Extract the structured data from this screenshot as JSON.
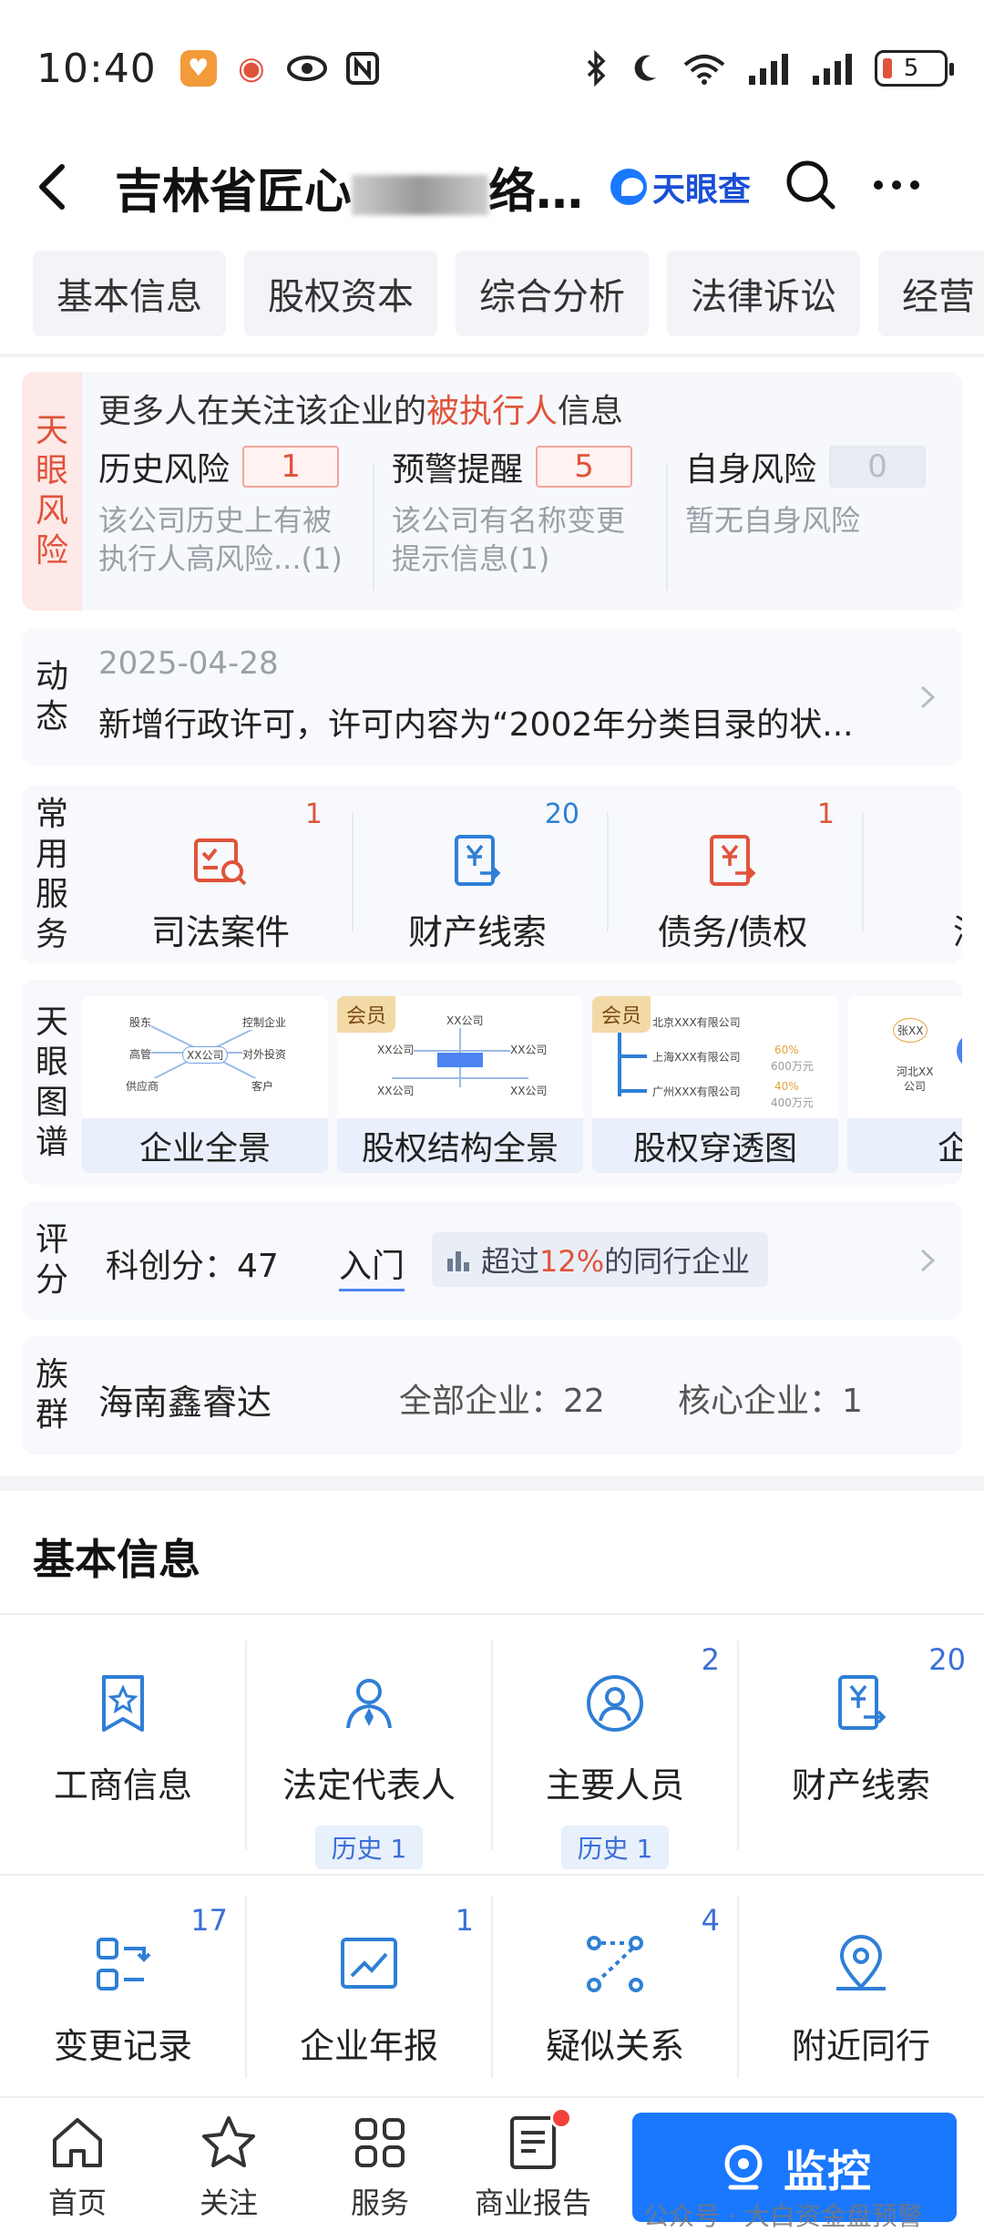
{
  "status_bar": {
    "time": "10:40",
    "battery": "5"
  },
  "header": {
    "title_prefix": "吉林省匠心",
    "title_suffix": "络...",
    "brand": "天眼查"
  },
  "tabs": [
    "基本信息",
    "股权资本",
    "综合分析",
    "法律诉讼",
    "经营"
  ],
  "risk": {
    "side_label": [
      "天",
      "眼",
      "风",
      "险"
    ],
    "headline_pre": "更多人在关注该企业的",
    "headline_hl": "被执行人",
    "headline_post": "信息",
    "items": [
      {
        "title": "历史风险",
        "count": "1",
        "desc1": "该公司历史上有被",
        "desc2": "执行人高风险...(1)"
      },
      {
        "title": "预警提醒",
        "count": "5",
        "desc1": "该公司有名称变更",
        "desc2": "提示信息(1)"
      },
      {
        "title": "自身风险",
        "count": "0",
        "desc1": "暂无自身风险",
        "desc2": ""
      }
    ]
  },
  "dynamic": {
    "side_label": [
      "动",
      "态"
    ],
    "date": "2025-04-28",
    "text": "新增行政许可，许可内容为“2002年分类目录的状..."
  },
  "services": {
    "side_label": [
      "常",
      "用",
      "服",
      "务"
    ],
    "items": [
      {
        "label": "司法案件",
        "count": "1"
      },
      {
        "label": "财产线索",
        "count": "20"
      },
      {
        "label": "债务/债权",
        "count": "1"
      },
      {
        "label": "深度",
        "count": ""
      }
    ]
  },
  "graph": {
    "side_label": [
      "天",
      "眼",
      "图",
      "谱"
    ],
    "vip": "会员",
    "items": [
      {
        "label": "企业全景"
      },
      {
        "label": "股权结构全景"
      },
      {
        "label": "股权穿透图"
      },
      {
        "label": "企业"
      }
    ],
    "mini1": [
      "股东",
      "控制企业",
      "高管",
      "XX公司",
      "对外投资",
      "供应商",
      "客户"
    ],
    "mini2": [
      "XX公司",
      "XX公司",
      "XX公司",
      "XX公司",
      "XX公司"
    ],
    "mini3": [
      "北京XXX有限公司",
      "上海XXX有限公司",
      "60%",
      "600万元",
      "广州XXX有限公司",
      "40%",
      "400万元"
    ],
    "mini4": [
      "张XX",
      "河北XX",
      "公司"
    ]
  },
  "score": {
    "side_label": [
      "评",
      "分"
    ],
    "text": "科创分：47",
    "level": "入门",
    "chip_pre": "超过",
    "chip_pct": "12%",
    "chip_post": "的同行企业"
  },
  "group": {
    "side_label": [
      "族",
      "群"
    ],
    "name": "海南鑫睿达",
    "all": "全部企业：22",
    "core": "核心企业：1"
  },
  "basic_info": {
    "title": "基本信息",
    "row1": [
      {
        "label": "工商信息",
        "count": "",
        "history": ""
      },
      {
        "label": "法定代表人",
        "count": "",
        "history": "历史 1"
      },
      {
        "label": "主要人员",
        "count": "2",
        "history": "历史 1"
      },
      {
        "label": "财产线索",
        "count": "20",
        "history": ""
      }
    ],
    "row2": [
      {
        "label": "变更记录",
        "count": "17"
      },
      {
        "label": "企业年报",
        "count": "1"
      },
      {
        "label": "疑似关系",
        "count": "4"
      },
      {
        "label": "附近同行",
        "count": ""
      }
    ]
  },
  "bottom_nav": {
    "items": [
      "首页",
      "关注",
      "服务",
      "商业报告"
    ],
    "monitor": "监控",
    "watermark": "公众号 · 大白资金盘预警"
  },
  "colors": {
    "accent": "#1a78ff",
    "risk_red": "#e0533b",
    "vip_gold": "#f3d9a6"
  }
}
